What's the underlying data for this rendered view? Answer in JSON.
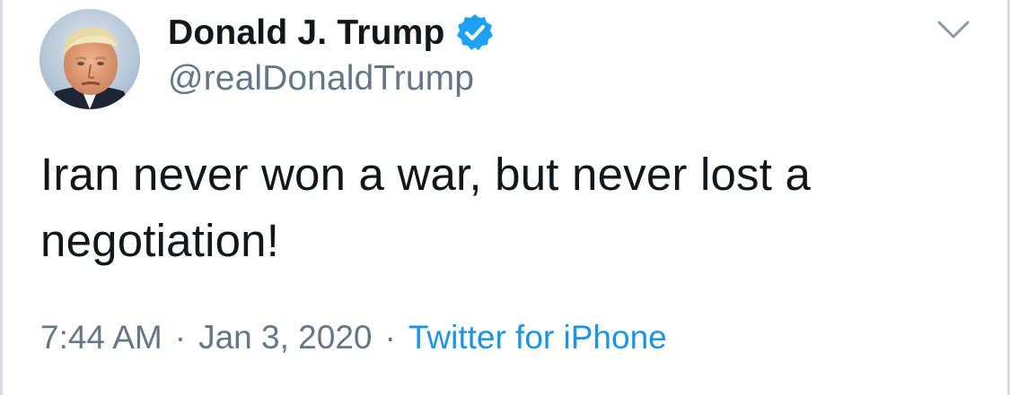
{
  "author": {
    "display_name": "Donald J. Trump",
    "handle": "@realDonaldTrump",
    "verified": true,
    "avatar_icon": "profile-photo"
  },
  "tweet": {
    "text": "Iran never won a war, but never lost a negotiation!"
  },
  "meta": {
    "time": "7:44 AM",
    "separator": "·",
    "date": "Jan 3, 2020",
    "source": "Twitter for iPhone"
  },
  "icons": {
    "verified": "verified-badge-icon",
    "menu": "chevron-down-icon"
  },
  "colors": {
    "text_primary": "#14171a",
    "text_secondary": "#657786",
    "link": "#1b95e0",
    "verified_badge": "#1da1f2",
    "caret": "#8899a6"
  }
}
